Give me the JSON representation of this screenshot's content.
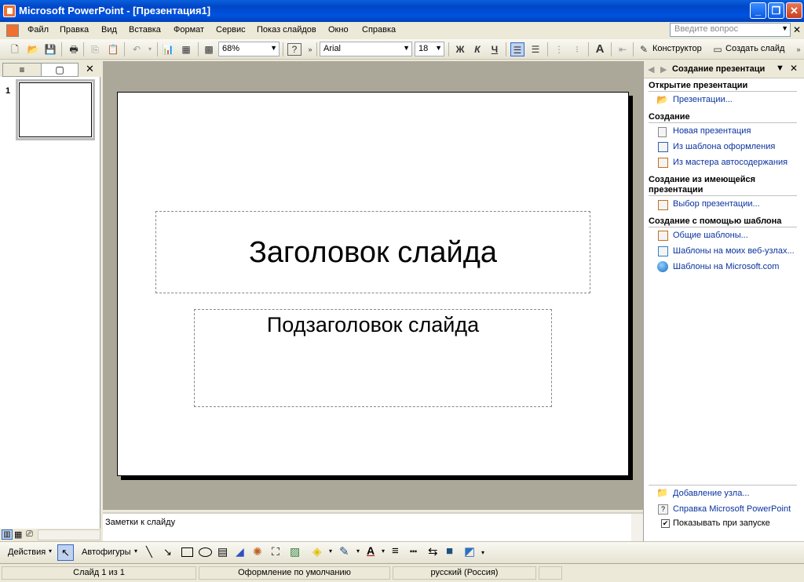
{
  "window": {
    "title": "Microsoft PowerPoint - [Презентация1]"
  },
  "menu": {
    "items": [
      "Файл",
      "Правка",
      "Вид",
      "Вставка",
      "Формат",
      "Сервис",
      "Показ слайдов",
      "Окно",
      "Справка"
    ],
    "ask_placeholder": "Введите вопрос"
  },
  "toolbar": {
    "zoom": "68%",
    "font": "Arial",
    "size": "18",
    "bold": "Ж",
    "italic": "К",
    "underline": "Ч",
    "designer": "Конструктор",
    "new_slide": "Создать слайд"
  },
  "slide_panel": {
    "thumb_number": "1"
  },
  "slide": {
    "title": "Заголовок слайда",
    "subtitle": "Подзаголовок слайда"
  },
  "notes": {
    "placeholder": "Заметки к слайду"
  },
  "task_pane": {
    "title": "Создание презентаци",
    "open_section": "Открытие презентации",
    "open_link": "Презентации...",
    "create_section": "Создание",
    "create_links": [
      "Новая презентация",
      "Из шаблона оформления",
      "Из мастера автосодержания"
    ],
    "from_existing_section_1": "Создание из имеющейся",
    "from_existing_section_2": "презентации",
    "from_existing_link": "Выбор презентации...",
    "template_section": "Создание с помощью шаблона",
    "template_links": [
      "Общие шаблоны...",
      "Шаблоны на моих веб-узлах...",
      "Шаблоны на Microsoft.com"
    ],
    "add_node": "Добавление узла...",
    "help_link": "Справка Microsoft PowerPoint",
    "show_at_startup": "Показывать при запуске"
  },
  "drawbar": {
    "actions": "Действия",
    "autoshapes": "Автофигуры"
  },
  "status": {
    "slide": "Слайд 1 из 1",
    "design": "Оформление по умолчанию",
    "language": "русский (Россия)"
  }
}
